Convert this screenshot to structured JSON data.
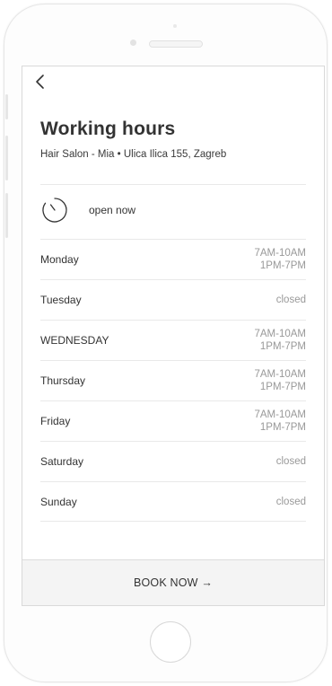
{
  "header": {
    "title": "Working hours",
    "subtitle": "Hair Salon - Mia • Ulica Ilica 155, Zagreb"
  },
  "status": {
    "label": "open now"
  },
  "schedule": [
    {
      "day": "Monday",
      "line1": "7AM-10AM",
      "line2": "1PM-7PM"
    },
    {
      "day": "Tuesday",
      "line1": "closed",
      "line2": ""
    },
    {
      "day": "WEDNESDAY",
      "line1": "7AM-10AM",
      "line2": "1PM-7PM"
    },
    {
      "day": "Thursday",
      "line1": "7AM-10AM",
      "line2": "1PM-7PM"
    },
    {
      "day": "Friday",
      "line1": "7AM-10AM",
      "line2": "1PM-7PM"
    },
    {
      "day": "Saturday",
      "line1": "closed",
      "line2": ""
    },
    {
      "day": "Sunday",
      "line1": "closed",
      "line2": ""
    }
  ],
  "footer": {
    "book_label": "BOOK NOW →"
  },
  "icons": {
    "back": "back-arrow-icon",
    "clock": "clock-icon"
  },
  "colors": {
    "text": "#333333",
    "muted": "#999999",
    "footer_bg": "#f4f4f4"
  }
}
